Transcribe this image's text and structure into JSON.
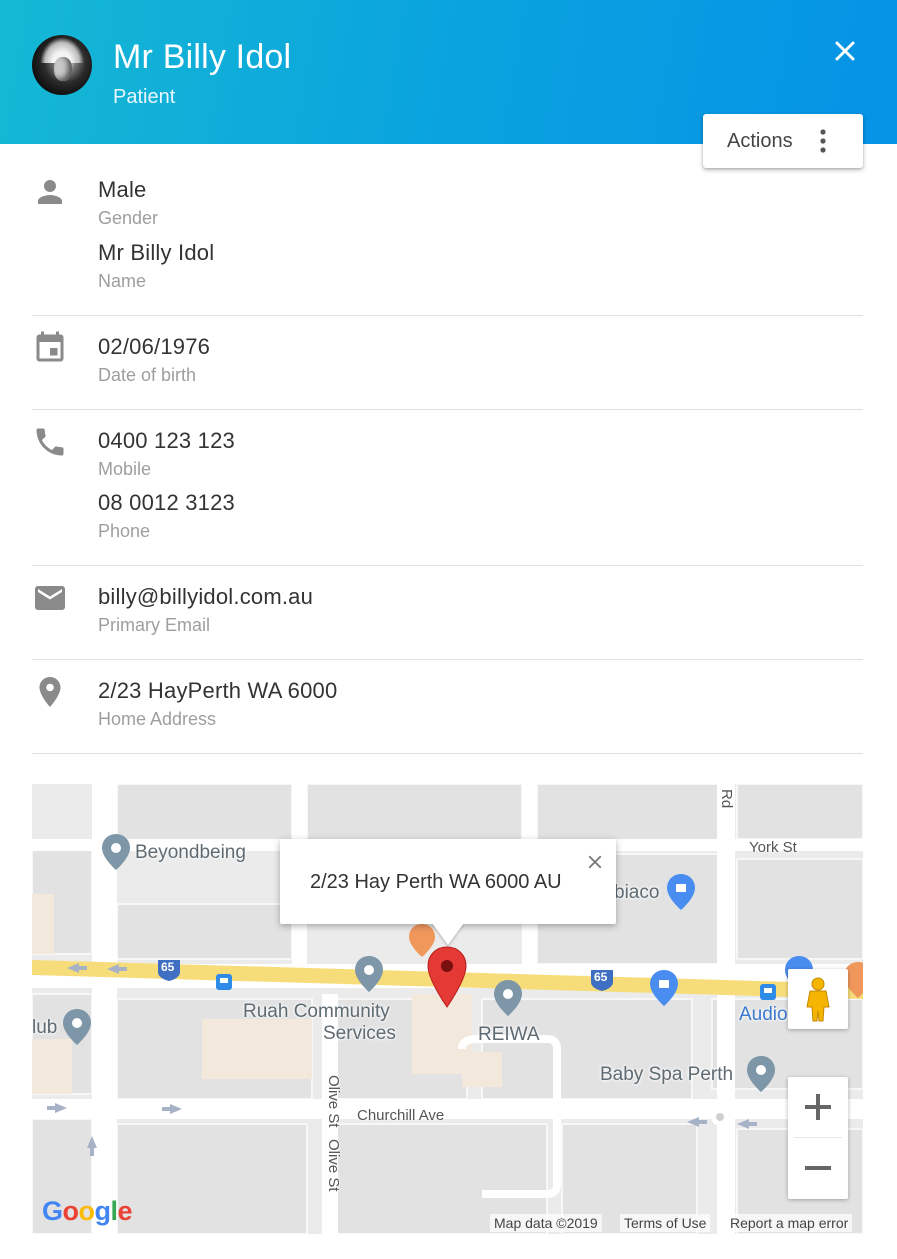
{
  "header": {
    "name": "Mr Billy Idol",
    "role": "Patient"
  },
  "actions": {
    "label": "Actions"
  },
  "sections": {
    "gender": {
      "value": "Male",
      "label": "Gender"
    },
    "name": {
      "value": "Mr Billy Idol",
      "label": "Name"
    },
    "dob": {
      "value": "02/06/1976",
      "label": "Date of birth"
    },
    "mobile": {
      "value": "0400 123 123",
      "label": "Mobile"
    },
    "phone": {
      "value": "08 0012 3123",
      "label": "Phone"
    },
    "email": {
      "value": "billy@billyidol.com.au",
      "label": "Primary Email"
    },
    "address": {
      "value": "2/23 HayPerth WA 6000",
      "label": "Home Address"
    }
  },
  "map": {
    "infowindow_text": "2/23 Hay Perth WA 6000 AU",
    "places": {
      "beyondbeing": "Beyondbeing",
      "york_st": "York St",
      "subiaco": "biaco",
      "club": "lub",
      "ruah1": "Ruah Community",
      "ruah2": "Services",
      "reiwa": "REIWA",
      "audio": "Audio",
      "baby_spa": "Baby Spa Perth",
      "churchill": "Churchill Ave",
      "olive1": "Olive St",
      "olive2": "Olive St",
      "rd": "Rd"
    },
    "route_badges": [
      "65",
      "65"
    ],
    "google_logo": "Google",
    "attribution": {
      "map_data": "Map data ©2019",
      "terms": "Terms of Use",
      "report": "Report a map error"
    }
  },
  "icons": {
    "close": "close-icon",
    "more": "more-vert-icon",
    "person": "person-icon",
    "calendar": "calendar-icon",
    "phone": "phone-icon",
    "email": "email-icon",
    "location": "location-pin-icon"
  },
  "colors": {
    "header_start": "#15b8d4",
    "header_end": "#0593e6",
    "icon_gray": "#8a8a8a",
    "map_marker": "#e53935"
  }
}
